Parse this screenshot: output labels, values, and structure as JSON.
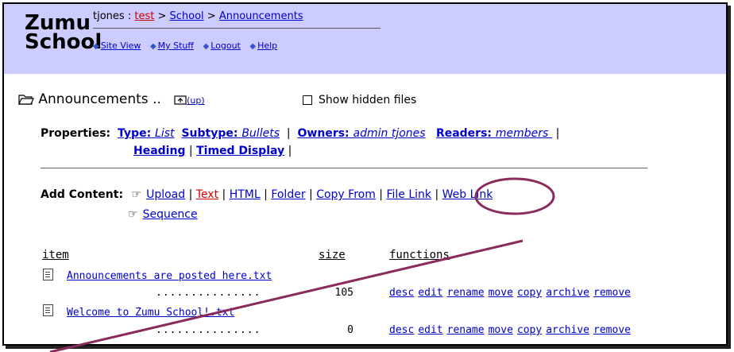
{
  "logo": "Zumu School",
  "breadcrumb": {
    "user": "tjones",
    "sep": ":",
    "items": [
      "test",
      "School",
      "Announcements"
    ]
  },
  "nav": [
    "Site View",
    "My Stuff",
    "Logout",
    "Help"
  ],
  "folder": {
    "name": "Announcements",
    "dots": "..",
    "up_label": "(up)",
    "show_hidden_label": "Show hidden files"
  },
  "properties": {
    "label": "Properties:",
    "type_label": "Type:",
    "type_value": "List",
    "subtype_label": "Subtype:",
    "subtype_value": "Bullets",
    "owners_label": "Owners:",
    "owners_value": "admin tjones",
    "readers_label": "Readers:",
    "readers_value": "members",
    "heading": "Heading",
    "timed_display": "Timed Display"
  },
  "add_content": {
    "label": "Add Content:",
    "links": [
      "Upload",
      "Text",
      "HTML",
      "Folder",
      "Copy From",
      "File Link",
      "Web Link"
    ],
    "sequence": "Sequence"
  },
  "table": {
    "headers": [
      "item",
      "size",
      "functions"
    ],
    "rows": [
      {
        "name": "Announcements are posted here.txt",
        "dots": "...............",
        "size": "105"
      },
      {
        "name": "Welcome to Zumu School!.txt",
        "dots": "...............",
        "size": "0"
      }
    ],
    "functions": [
      "desc",
      "edit",
      "rename",
      "move",
      "copy",
      "archive",
      "remove"
    ]
  },
  "colors": {
    "header_bg": "#ccccff",
    "link": "#0000cc",
    "annotation": "#8b2a5c"
  }
}
